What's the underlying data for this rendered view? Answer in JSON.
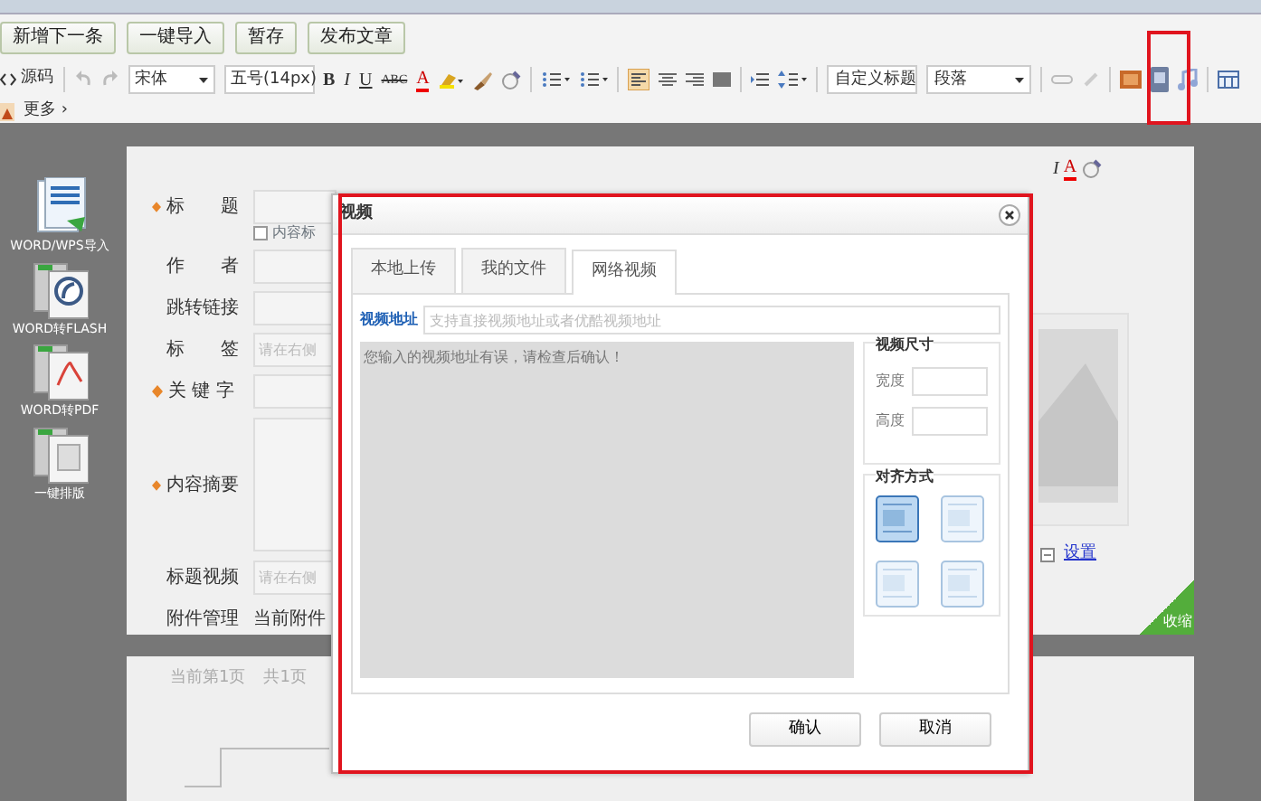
{
  "action_buttons": [
    "新增下一条",
    "一键导入",
    "暂存",
    "发布文章"
  ],
  "toolbar": {
    "source_label": "源码",
    "font": "宋体",
    "font_size": "五号(14px)",
    "bold": "B",
    "italic": "I",
    "underline": "U",
    "strike": "ABC",
    "font_color": "A",
    "heading": "自定义标题",
    "paragraph": "段落",
    "more": "更多 ›"
  },
  "sidebar": [
    {
      "label": "WORD/WPS导入",
      "kind": "word"
    },
    {
      "label": "WORD转FLASH",
      "kind": "flash"
    },
    {
      "label": "WORD转PDF",
      "kind": "pdf"
    },
    {
      "label": "一键排版",
      "kind": "layout"
    }
  ],
  "form": {
    "fields": [
      {
        "label": "标　　题",
        "required": true,
        "kind": "input"
      },
      {
        "label": "内容标",
        "kind": "checkbox",
        "checked": false
      },
      {
        "label": "作　　者",
        "required": false,
        "kind": "input"
      },
      {
        "label": "跳转链接",
        "required": false,
        "kind": "input"
      },
      {
        "label": "标　　签",
        "required": false,
        "kind": "input",
        "placeholder": "请在右侧"
      },
      {
        "label": "关 键 字",
        "required": true,
        "kind": "input"
      },
      {
        "label": "内容摘要",
        "required": true,
        "kind": "textarea"
      },
      {
        "label": "标题视频",
        "required": false,
        "kind": "input",
        "placeholder": "请在右侧"
      },
      {
        "label": "附件管理",
        "required": false,
        "kind": "text",
        "value": "当前附件"
      }
    ],
    "side_italic": "I",
    "side_color": "A",
    "image_link": "设置",
    "collapse": "收缩"
  },
  "pager": [
    "当前第1页",
    "共1页"
  ],
  "dialog": {
    "title": "视频",
    "tabs": [
      {
        "label": "本地上传",
        "selected": false
      },
      {
        "label": "我的文件",
        "selected": false
      },
      {
        "label": "网络视频",
        "selected": true
      }
    ],
    "url_label": "视频地址",
    "url_placeholder": "支持直接视频地址或者优酷视频地址",
    "error": "您输入的视频地址有误，请检查后确认！",
    "size_title": "视频尺寸",
    "width_label": "宽度",
    "height_label": "高度",
    "align_title": "对齐方式",
    "align_options": [
      {
        "selected": true
      },
      {
        "selected": false
      },
      {
        "selected": false
      },
      {
        "selected": false
      }
    ],
    "buttons": [
      "确认",
      "取消"
    ]
  }
}
